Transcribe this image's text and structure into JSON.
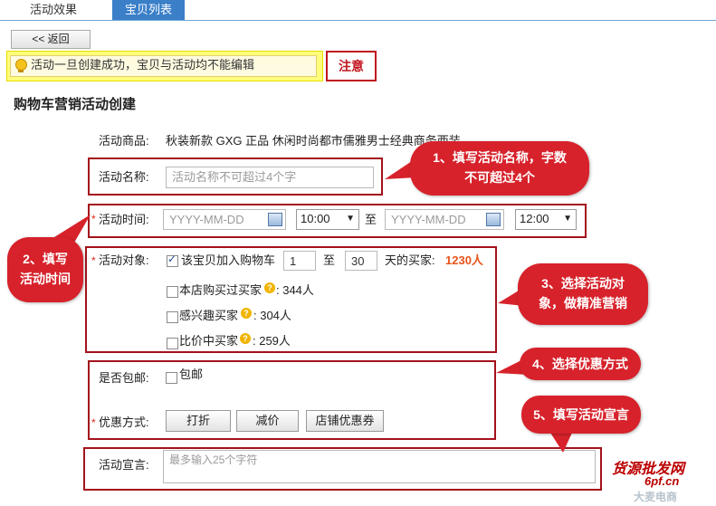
{
  "tabs": [
    {
      "label": "活动效果"
    },
    {
      "label": "宝贝列表"
    }
  ],
  "back_label": "<< 返回",
  "notice_text": "活动一旦创建成功，宝贝与活动均不能编辑",
  "callouts": {
    "note": "注意",
    "c1_l1": "1、填写活动名称，字数",
    "c1_l2": "不可超过4个",
    "c2_l1": "2、填写",
    "c2_l2": "活动时间",
    "c3_l1": "3、选择活动对",
    "c3_l2": "象，做精准营销",
    "c4": "4、选择优惠方式",
    "c5": "5、填写活动宣言"
  },
  "page_title": "购物车营销活动创建",
  "form": {
    "product_label": "活动商品:",
    "product_value": "秋装新款 GXG 正品 休闲时尚都市儒雅男士经典商务西装",
    "name_label": "活动名称:",
    "name_placeholder": "活动名称不可超过4个字",
    "time_label": "活动时间:",
    "date_placeholder": "YYYY-MM-DD",
    "start_time": "10:00",
    "to_label": "至",
    "end_time": "12:00",
    "target_label": "活动对象:",
    "target_cart_label": "该宝贝加入购物车",
    "cart_from": "1",
    "cart_to": "30",
    "days_label": "天的买家:",
    "cart_count": "1230人",
    "target_bought_label": "本店购买过买家",
    "bought_count": ": 344人",
    "target_interest_label": "感兴趣买家",
    "interest_count": ": 304人",
    "target_compare_label": "比价中买家",
    "compare_count": ": 259人",
    "shipping_label": "是否包邮:",
    "shipping_option": "包邮",
    "discount_label": "优惠方式:",
    "discount_options": [
      "打折",
      "减价",
      "店铺优惠券"
    ],
    "slogan_label": "活动宣言:",
    "slogan_placeholder": "最多输入25个字符"
  },
  "watermark": {
    "l1": "货源批发网",
    "l2": "6pf.cn",
    "l3": "大麦电商"
  },
  "colors": {
    "accent_blue": "#3a7fc8",
    "callout_red": "#d7222b",
    "box_red": "#a3121b",
    "count_orange": "#e8531a",
    "notice_yellow": "#fffd7a"
  }
}
